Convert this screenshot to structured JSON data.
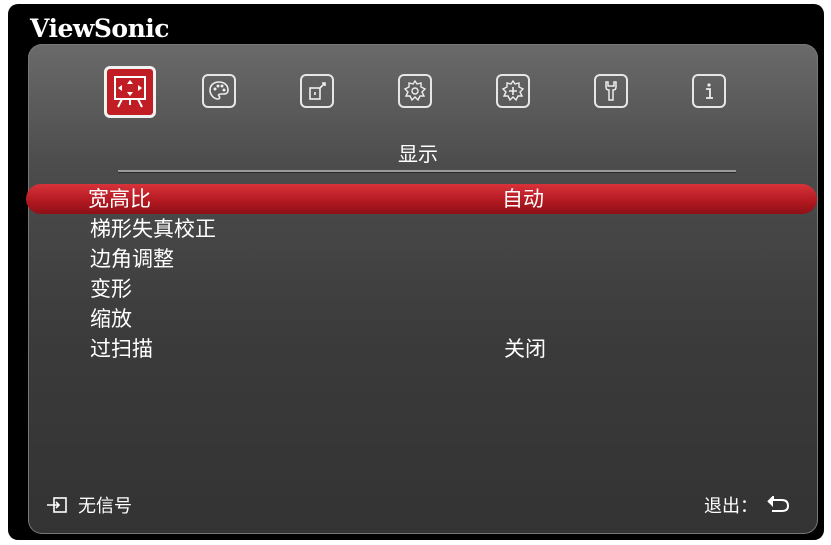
{
  "brand": "ViewSonic",
  "tabs": [
    {
      "icon": "display-icon",
      "active": true
    },
    {
      "icon": "palette-icon"
    },
    {
      "icon": "source-icon"
    },
    {
      "icon": "gear-icon"
    },
    {
      "icon": "advanced-gear-icon"
    },
    {
      "icon": "wrench-icon"
    },
    {
      "icon": "info-icon"
    }
  ],
  "tab_title": "显示",
  "menu": [
    {
      "label": "宽高比",
      "value": "自动",
      "selected": true
    },
    {
      "label": "梯形失真校正",
      "value": ""
    },
    {
      "label": "边角调整",
      "value": ""
    },
    {
      "label": "变形",
      "value": ""
    },
    {
      "label": "缩放",
      "value": ""
    },
    {
      "label": "过扫描",
      "value": "关闭"
    }
  ],
  "footer": {
    "status": "无信号",
    "exit_label": "退出："
  },
  "colors": {
    "accent": "#c01e24",
    "background": "#000000",
    "panel": "#4c4c4c"
  }
}
